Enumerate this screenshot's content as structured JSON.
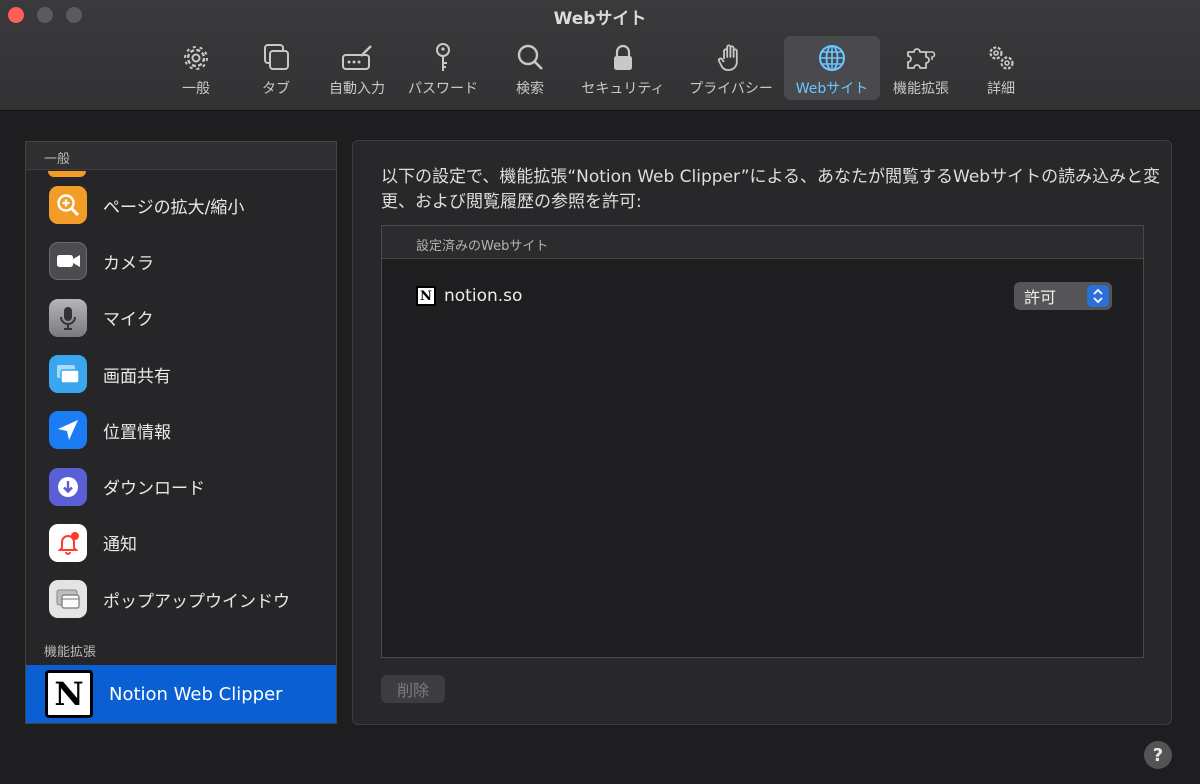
{
  "window": {
    "title": "Webサイト"
  },
  "toolbar": {
    "items": [
      {
        "label": "一般",
        "icon": "gear-icon"
      },
      {
        "label": "タブ",
        "icon": "tabs-icon"
      },
      {
        "label": "自動入力",
        "icon": "autofill-icon"
      },
      {
        "label": "パスワード",
        "icon": "key-icon"
      },
      {
        "label": "検索",
        "icon": "search-icon"
      },
      {
        "label": "セキュリティ",
        "icon": "lock-icon"
      },
      {
        "label": "プライバシー",
        "icon": "hand-icon"
      },
      {
        "label": "Webサイト",
        "icon": "globe-icon",
        "active": true
      },
      {
        "label": "機能拡張",
        "icon": "puzzle-icon"
      },
      {
        "label": "詳細",
        "icon": "gears-icon"
      }
    ],
    "active_color": "#69c8ff"
  },
  "sidebar": {
    "general_header": "一般",
    "items": [
      {
        "label": "ページの拡大/縮小",
        "icon": "zoom-icon",
        "color": "#f29d28"
      },
      {
        "label": "カメラ",
        "icon": "camera-icon",
        "color": "#4c4c50"
      },
      {
        "label": "マイク",
        "icon": "microphone-icon",
        "color": "#8e8e93"
      },
      {
        "label": "画面共有",
        "icon": "screen-share-icon",
        "color": "#3aa6f0"
      },
      {
        "label": "位置情報",
        "icon": "location-arrow-icon",
        "color": "#1b7cf5"
      },
      {
        "label": "ダウンロード",
        "icon": "download-icon",
        "color": "#5b5fd6"
      },
      {
        "label": "通知",
        "icon": "bell-icon",
        "color": "#ffffff"
      },
      {
        "label": "ポップアップウインドウ",
        "icon": "popup-window-icon",
        "color": "#e4e4e4"
      }
    ],
    "extensions_header": "機能拡張",
    "extension": {
      "label": "Notion Web Clipper",
      "logo_letter": "N",
      "selected_color": "#0a5fd3"
    }
  },
  "main": {
    "description": "以下の設定で、機能拡張“Notion Web Clipper”による、あなたが閲覧するWebサイトの読み込みと変更、および閲覧履歴の参照を許可:",
    "sites_header": "設定済みのWebサイト",
    "sites": [
      {
        "name": "notion.so",
        "logo_letter": "N",
        "permission": "許可"
      }
    ],
    "delete_label": "削除"
  },
  "help": {
    "label": "?"
  }
}
